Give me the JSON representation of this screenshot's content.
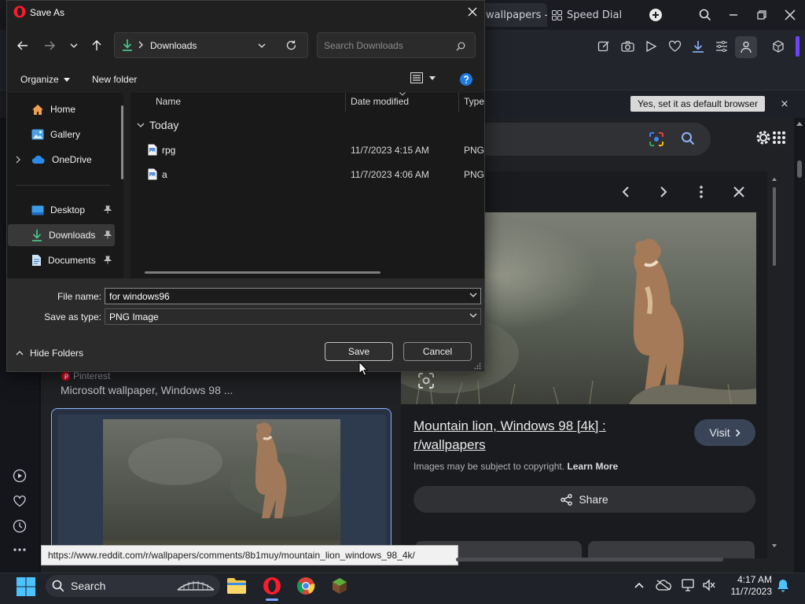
{
  "browser": {
    "tabs": [
      {
        "label": "wallpapers - G",
        "active": true
      },
      {
        "label": "Speed Dial",
        "active": false
      }
    ],
    "default_browser_prompt": "Yes, set it as default browser",
    "default_browser_close": "×",
    "left_result": {
      "source": "Pinterest",
      "title": "Microsoft wallpaper, Windows 98 ..."
    },
    "preview": {
      "title": "Mountain lion, Windows 98 [4k] : r/wallpapers",
      "visit_label": "Visit",
      "copyright_text": "Images may be subject to copyright.",
      "learn_more": "Learn More",
      "share_label": "Share"
    },
    "status_url": "https://www.reddit.com/r/wallpapers/comments/8b1muy/mountain_lion_windows_98_4k/"
  },
  "taskbar": {
    "search_label": "Search",
    "time": "4:17 AM",
    "date": "11/7/2023"
  },
  "dialog": {
    "title": "Save As",
    "address": {
      "folder": "Downloads"
    },
    "search_placeholder": "Search Downloads",
    "organize_label": "Organize",
    "new_folder_label": "New folder",
    "nav": [
      {
        "label": "Home",
        "icon": "home-icon"
      },
      {
        "label": "Gallery",
        "icon": "gallery-icon"
      },
      {
        "label": "OneDrive",
        "icon": "onedrive-icon"
      },
      {
        "label": "Desktop",
        "icon": "desktop-icon",
        "pinned": true
      },
      {
        "label": "Downloads",
        "icon": "downloads-icon",
        "pinned": true,
        "selected": true
      },
      {
        "label": "Documents",
        "icon": "documents-icon",
        "pinned": true
      }
    ],
    "columns": {
      "name": "Name",
      "date": "Date modified",
      "type": "Type"
    },
    "group_label": "Today",
    "files": [
      {
        "name": "rpg",
        "date": "11/7/2023 4:15 AM",
        "type": "PNG"
      },
      {
        "name": "a",
        "date": "11/7/2023 4:06 AM",
        "type": "PNG"
      }
    ],
    "filename_label": "File name:",
    "filename_value": "for windows96",
    "savetype_label": "Save as type:",
    "savetype_value": "PNG Image",
    "hide_folders_label": "Hide Folders",
    "save_label": "Save",
    "cancel_label": "Cancel"
  },
  "colors": {
    "opera_red": "#ff1b2d",
    "accent_blue": "#8ab4f8",
    "dialog_bg": "#202020"
  }
}
